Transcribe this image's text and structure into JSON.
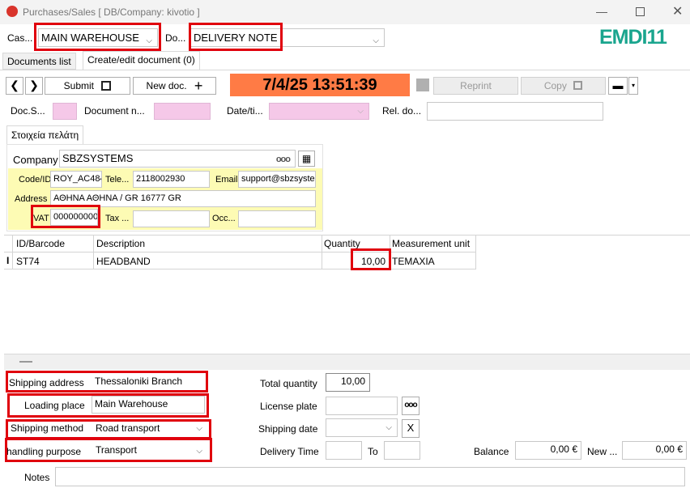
{
  "window": {
    "title": "Purchases/Sales    [ DB/Company: kivotio ]"
  },
  "brand": {
    "logo_text": "EMDI11",
    "color": "#1aa58e"
  },
  "top": {
    "cash_label": "Cas...",
    "cash_value": "MAIN WAREHOUSE",
    "doc_label": "Do...",
    "doc_value": "DELIVERY NOTE"
  },
  "tabs": {
    "documents_list": "Documents list",
    "create_edit": "Create/edit document (0)"
  },
  "toolbar": {
    "submit": "Submit",
    "new_doc": "New doc.",
    "datetime": "7/4/25 13:51:39",
    "reprint": "Reprint",
    "copy": "Copy"
  },
  "doc_fields": {
    "series_label": "Doc.S...",
    "number_label": "Document n...",
    "date_label": "Date/ti...",
    "rel_label": "Rel. do..."
  },
  "customer": {
    "tab": "Στοιχεία πελάτη",
    "company_label": "Company",
    "company_value": "SBZSYSTEMS",
    "code_label": "Code/ID",
    "code_value": "ROY_AC484",
    "tel_label": "Tele...",
    "tel_value": "2118002930",
    "email_label": "Email",
    "email_value": "support@sbzsystems",
    "address_label": "Address",
    "address_value": "ΑΘΗΝΑ ΑΘΗΝΑ / GR 16777 GR",
    "vat_label": "VAT",
    "vat_value": "000000000",
    "tax_label": "Tax ...",
    "occ_label": "Occ..."
  },
  "grid": {
    "headers": [
      "ID/Barcode",
      "Description",
      "Quantity",
      "Measurement unit"
    ],
    "rows": [
      {
        "marker": "I",
        "id": "ST74",
        "description": "HEADBAND",
        "quantity": "10,00",
        "unit": "TEMAXIA"
      }
    ]
  },
  "shipping": {
    "address_label": "Shipping address",
    "address_value": "Thessaloniki Branch",
    "loading_label": "Loading place",
    "loading_value": "Main Warehouse",
    "method_label": "Shipping method",
    "method_value": "Road transport",
    "purpose_label": "handling purpose",
    "purpose_value": "Transport"
  },
  "totals": {
    "total_qty_label": "Total quantity",
    "total_qty_value": "10,00",
    "license_label": "License plate",
    "ship_date_label": "Shipping date",
    "delivery_time_label": "Delivery Time",
    "to_label": "To",
    "balance_label": "Balance",
    "balance_value": "0,00 €",
    "new_label": "New ...",
    "new_value": "0,00 €",
    "notes_label": "Notes"
  }
}
